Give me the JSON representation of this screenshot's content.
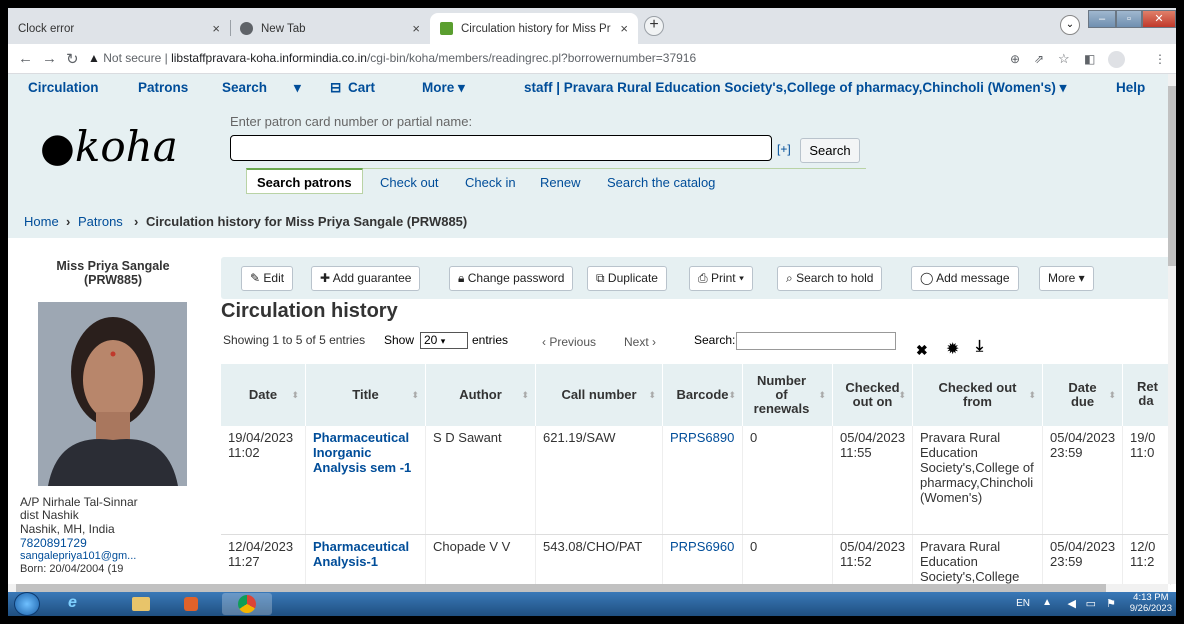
{
  "browser": {
    "tabs": [
      {
        "label": "Clock error"
      },
      {
        "label": "New Tab"
      },
      {
        "label": "Circulation history for Miss Priya"
      }
    ],
    "url_security": "Not secure",
    "url_host": "libstaffpravara-koha.informindia.co.in",
    "url_path": "/cgi-bin/koha/members/readingrec.pl?borrowernumber=37916"
  },
  "koha_nav": {
    "circulation": "Circulation",
    "patrons": "Patrons",
    "search": "Search",
    "cart": "Cart",
    "more": "More",
    "user": "staff",
    "library": "Pravara Rural Education Society's,College of pharmacy,Chincholi (Women's)",
    "help": "Help"
  },
  "header": {
    "logo": "koha",
    "search_label": "Enter patron card number or partial name:",
    "search_plus": "[+]",
    "search_button": "Search",
    "tabs": [
      "Search patrons",
      "Check out",
      "Check in",
      "Renew",
      "Search the catalog"
    ]
  },
  "breadcrumb": {
    "home": "Home",
    "patrons": "Patrons",
    "current": "Circulation history for Miss Priya Sangale (PRW885)"
  },
  "patron": {
    "name": "Miss Priya Sangale",
    "card": "(PRW885)",
    "address1": "A/P Nirhale Tal-Sinnar",
    "address2": "dist Nashik",
    "address3": "Nashik, MH, India",
    "phone": "7820891729",
    "email": "sangalepriya101@gm...",
    "born": "Born: 20/04/2004 (19"
  },
  "toolbar": {
    "edit": "Edit",
    "add_guarantee": "Add guarantee",
    "change_password": "Change password",
    "duplicate": "Duplicate",
    "print": "Print",
    "search_to_hold": "Search to hold",
    "add_message": "Add message",
    "more": "More"
  },
  "content": {
    "title": "Circulation history",
    "showing": "Showing 1 to 5 of 5 entries",
    "show": "Show",
    "page_size": "20",
    "entries": "entries",
    "previous": "Previous",
    "next": "Next",
    "search_label": "Search:"
  },
  "table": {
    "headers": [
      "Date",
      "Title",
      "Author",
      "Call number",
      "Barcode",
      "Number of renewals",
      "Checked out on",
      "Checked out from",
      "Date due",
      "Return date"
    ],
    "header_visible": [
      "Date",
      "Title",
      "Author",
      "Call number",
      "Barcode",
      "Number of renewals",
      "Checked out on",
      "Checked out from",
      "Date due",
      "Ret da"
    ],
    "rows": [
      {
        "date": "19/04/2023 11:02",
        "title": "Pharmaceutical Inorganic Analysis sem -1",
        "author": "S D Sawant",
        "call_number": "621.19/SAW",
        "barcode": "PRPS6890",
        "renewals": "0",
        "checked_out_on": "05/04/2023 11:55",
        "checked_out_from": "Pravara Rural Education Society's,College of pharmacy,Chincholi (Women's)",
        "date_due": "05/04/2023 23:59",
        "return_date": "19/0 11:0"
      },
      {
        "date": "12/04/2023 11:27",
        "title": "Pharmaceutical Analysis-1",
        "author": "Chopade V V",
        "call_number": "543.08/CHO/PAT",
        "barcode": "PRPS6960",
        "renewals": "0",
        "checked_out_on": "05/04/2023 11:52",
        "checked_out_from": "Pravara Rural Education Society's,College",
        "date_due": "05/04/2023 23:59",
        "return_date": "12/0 11:2"
      }
    ]
  },
  "taskbar": {
    "lang": "EN",
    "time": "4:13 PM",
    "date": "9/26/2023"
  }
}
